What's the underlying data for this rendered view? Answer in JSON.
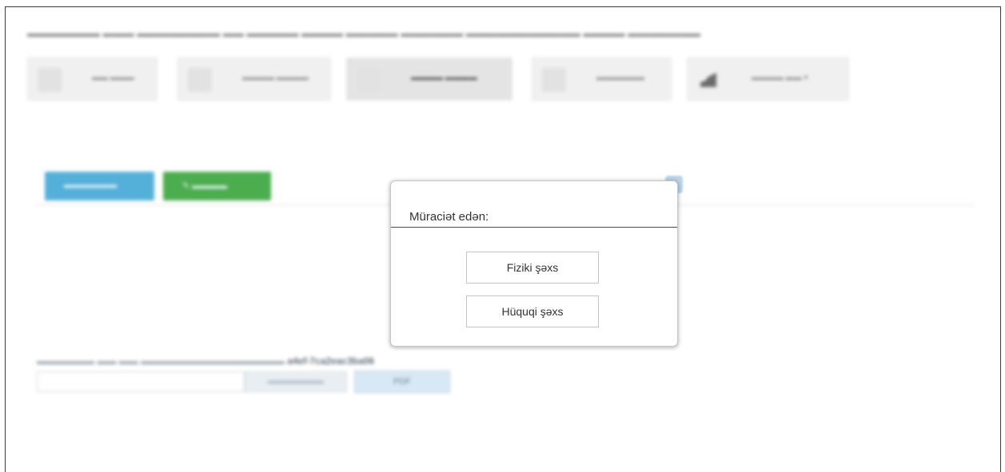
{
  "modal": {
    "title": "Müraciət edən:",
    "options": [
      {
        "label": "Fiziki şəxs"
      },
      {
        "label": "Hüquqi şəxs"
      }
    ]
  },
  "background": {
    "document_code_visible": "a4ef-7ca2eac3ba06",
    "pdf_button": "PDF"
  },
  "icons": {
    "close": "close-icon",
    "chart": "chart-icon",
    "pencil": "pencil-icon"
  },
  "colors": {
    "accent_blue": "#55b0d9",
    "accent_green": "#4cad4f"
  }
}
